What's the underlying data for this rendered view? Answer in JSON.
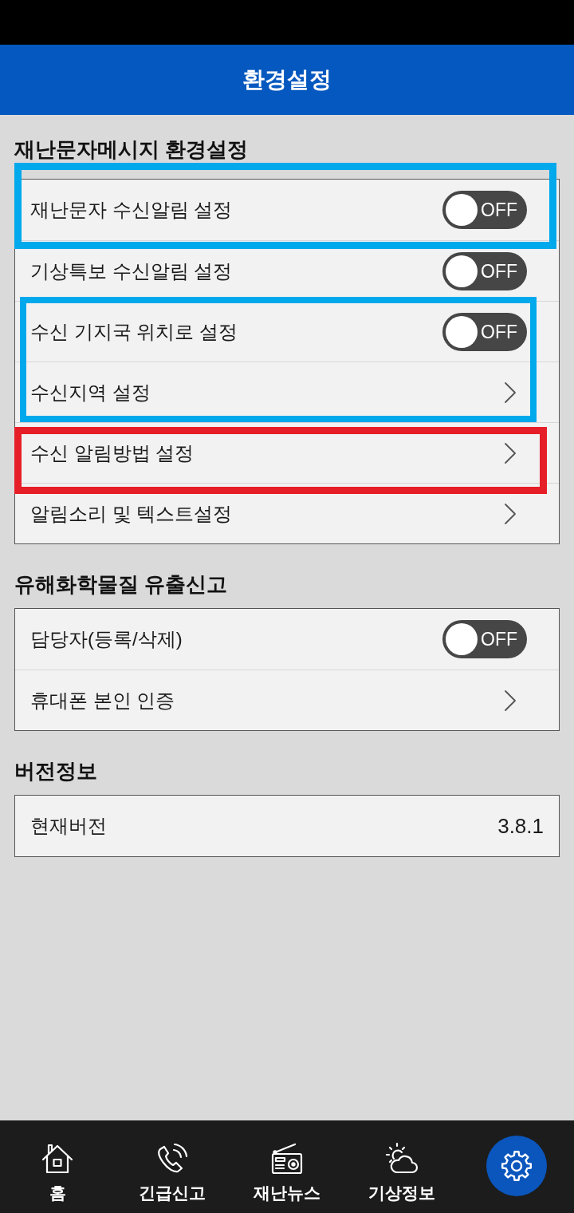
{
  "header": {
    "title": "환경설정"
  },
  "sections": [
    {
      "title": "재난문자메시지 환경설정",
      "groups": [
        {
          "color": "#00a8ec",
          "rows": [
            {
              "kind": "toggle",
              "label": "재난문자 수신알림 설정",
              "on": false,
              "switch_text": "OFF"
            }
          ]
        },
        {
          "rows": [
            {
              "kind": "toggle",
              "label": "기상특보 수신알림 설정",
              "on": false,
              "switch_text": "OFF"
            }
          ]
        },
        {
          "color": "#00a8ec",
          "rows": [
            {
              "kind": "toggle",
              "label": "수신 기지국 위치로 설정",
              "on": false,
              "switch_text": "OFF"
            },
            {
              "kind": "link",
              "label": "수신지역 설정"
            }
          ]
        },
        {
          "color": "#e61e28",
          "rows": [
            {
              "kind": "link",
              "label": "수신 알림방법 설정"
            }
          ]
        },
        {
          "rows": [
            {
              "kind": "link",
              "label": "알림소리 및 텍스트설정"
            }
          ]
        }
      ]
    },
    {
      "title": "유해화학물질 유출신고",
      "groups": [
        {
          "rows": [
            {
              "kind": "toggle",
              "label": "담당자(등록/삭제)",
              "on": false,
              "switch_text": "OFF"
            },
            {
              "kind": "link",
              "label": "휴대폰 본인 인증"
            }
          ]
        }
      ]
    },
    {
      "title": "버전정보",
      "groups": [
        {
          "rows": [
            {
              "kind": "value",
              "label": "현재버전",
              "value": "3.8.1"
            }
          ]
        }
      ]
    }
  ],
  "nav": [
    {
      "kind": "home",
      "label": "홈",
      "selected": false
    },
    {
      "kind": "call",
      "label": "긴급신고",
      "selected": false
    },
    {
      "kind": "radio",
      "label": "재난뉴스",
      "selected": false
    },
    {
      "kind": "weather",
      "label": "기상정보",
      "selected": false
    },
    {
      "kind": "settings",
      "selected": true
    }
  ]
}
